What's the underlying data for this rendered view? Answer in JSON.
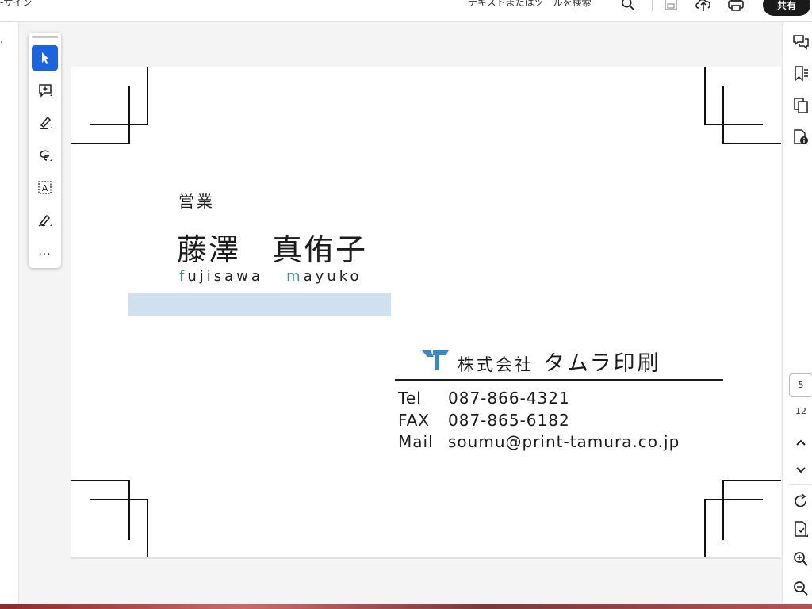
{
  "topbar": {
    "left_text": "-サイン",
    "search_placeholder": "テキストまたはツールを検索",
    "share_label": "共有",
    "icons": [
      "search-icon",
      "save-icon",
      "cloud-upload-icon",
      "print-icon"
    ]
  },
  "tools": {
    "items": [
      "select-cursor-icon",
      "add-comment-icon",
      "highlight-pen-icon",
      "freehand-draw-icon",
      "text-recognition-icon",
      "sign-pen-icon",
      "more-icon"
    ],
    "more_label": "...",
    "active_color": "#1b64e0"
  },
  "card": {
    "department": "営業",
    "name_jp": "藤澤　真侑子",
    "name_roman_first_initial": "f",
    "name_roman_first_rest": "ujisawa",
    "name_roman_last_initial": "m",
    "name_roman_last_rest": "ayuko",
    "company_corp": "株式会社",
    "company_brand": "タムラ印刷",
    "contacts": [
      {
        "label": "Tel",
        "value": "087-866-4321"
      },
      {
        "label": "FAX",
        "value": "087-865-6182"
      },
      {
        "label": "Mail",
        "value": "soumu@print-tamura.co.jp"
      }
    ],
    "accent_color": "#3d86c6",
    "bar_color": "#cfe0ee"
  },
  "rightrail": {
    "icons": [
      "comments-icon",
      "bookmarks-icon",
      "pages-icon",
      "document-info-icon",
      "rotate-icon",
      "page-extract-icon",
      "zoom-in-icon",
      "zoom-out-icon"
    ],
    "current_page": "5",
    "total_pages": "12"
  }
}
